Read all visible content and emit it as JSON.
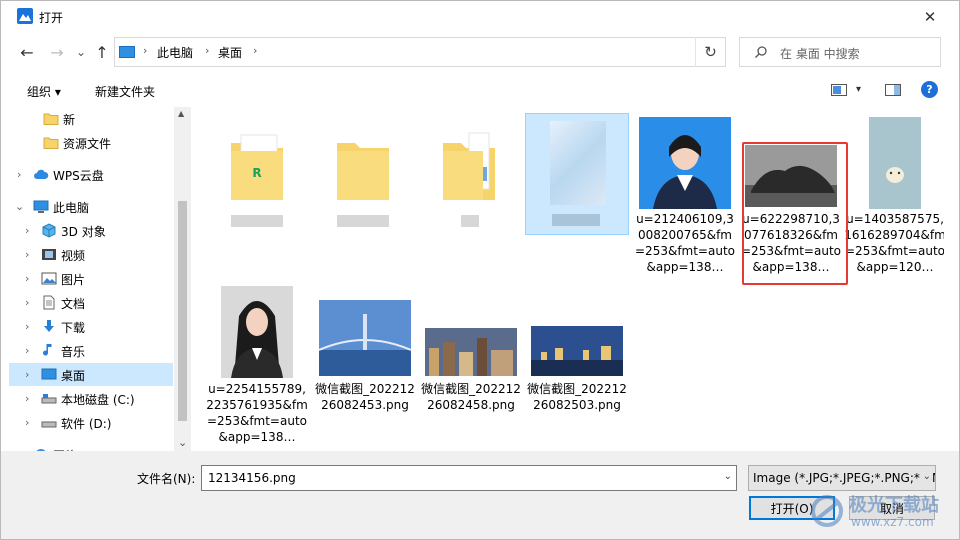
{
  "window": {
    "title": "打开",
    "close_glyph": "✕"
  },
  "nav": {
    "back_glyph": "←",
    "forward_glyph": "→",
    "recent_glyph": "⌄",
    "up_glyph": "↑",
    "breadcrumb": [
      "此电脑",
      "桌面"
    ],
    "crumb_sep": "›",
    "refresh_glyph": "↻",
    "search_placeholder": "在 桌面 中搜索"
  },
  "toolbar": {
    "organize_label": "组织 ▾",
    "new_folder_label": "新建文件夹",
    "view_dropdown_glyph": "▾",
    "help_glyph": "?"
  },
  "sidebar": {
    "items": [
      {
        "label": "新",
        "icon": "folder-icon"
      },
      {
        "label": "资源文件",
        "icon": "folder-icon"
      },
      {
        "label": "WPS云盘",
        "icon": "cloud-icon"
      },
      {
        "label": "此电脑",
        "icon": "computer-icon"
      },
      {
        "label": "3D 对象",
        "icon": "cube-icon"
      },
      {
        "label": "视频",
        "icon": "film-icon"
      },
      {
        "label": "图片",
        "icon": "picture-icon"
      },
      {
        "label": "文档",
        "icon": "document-icon"
      },
      {
        "label": "下载",
        "icon": "download-arrow-icon"
      },
      {
        "label": "音乐",
        "icon": "music-note-icon"
      },
      {
        "label": "桌面",
        "icon": "desktop-icon"
      },
      {
        "label": "本地磁盘 (C:)",
        "icon": "drive-icon"
      },
      {
        "label": "软件 (D:)",
        "icon": "drive-icon"
      },
      {
        "label": "网络",
        "icon": "network-icon"
      }
    ],
    "expand_glyph": "›",
    "expanded_glyph": "⌄",
    "scroll_up": "▲",
    "scroll_down": "⌄"
  },
  "files": [
    {
      "name": "",
      "kind": "folder"
    },
    {
      "name": "",
      "kind": "folder"
    },
    {
      "name": "",
      "kind": "folder"
    },
    {
      "name": "",
      "kind": "blurred"
    },
    {
      "name": "u=212406109,3008200765&fm=253&fmt=auto&app=138…",
      "kind": "portrait-photo"
    },
    {
      "name": "u=622298710,3077618326&fm=253&fmt=auto&app=138…",
      "kind": "rock-photo"
    },
    {
      "name": "u=1403587575,1616289704&fm=253&fmt=auto&app=120…",
      "kind": "cartoon-image"
    },
    {
      "name": "u=2254155789,2235761935&fm=253&fmt=auto&app=138…",
      "kind": "portrait-photo-2"
    },
    {
      "name": "微信截图_20221226082453.png",
      "kind": "bridge-photo"
    },
    {
      "name": "微信截图_20221226082458.png",
      "kind": "city-photo"
    },
    {
      "name": "微信截图_20221226082503.png",
      "kind": "skyline-photo"
    }
  ],
  "footer": {
    "filename_label": "文件名(N):",
    "filename_value": "12134156.png",
    "filter_value": "Image (*.JPG;*.JPEG;*.PNG;*.BMP)",
    "open_label": "打开(O)",
    "cancel_label": "取消",
    "dropdown_glyph": "⌄",
    "watermark_text": "极光下载站",
    "watermark_url": "www.xz7.com"
  },
  "colors": {
    "accent": "#0078d7",
    "highlight": "#e53935",
    "selection": "#cce8ff",
    "folder": "#f6d36b"
  }
}
